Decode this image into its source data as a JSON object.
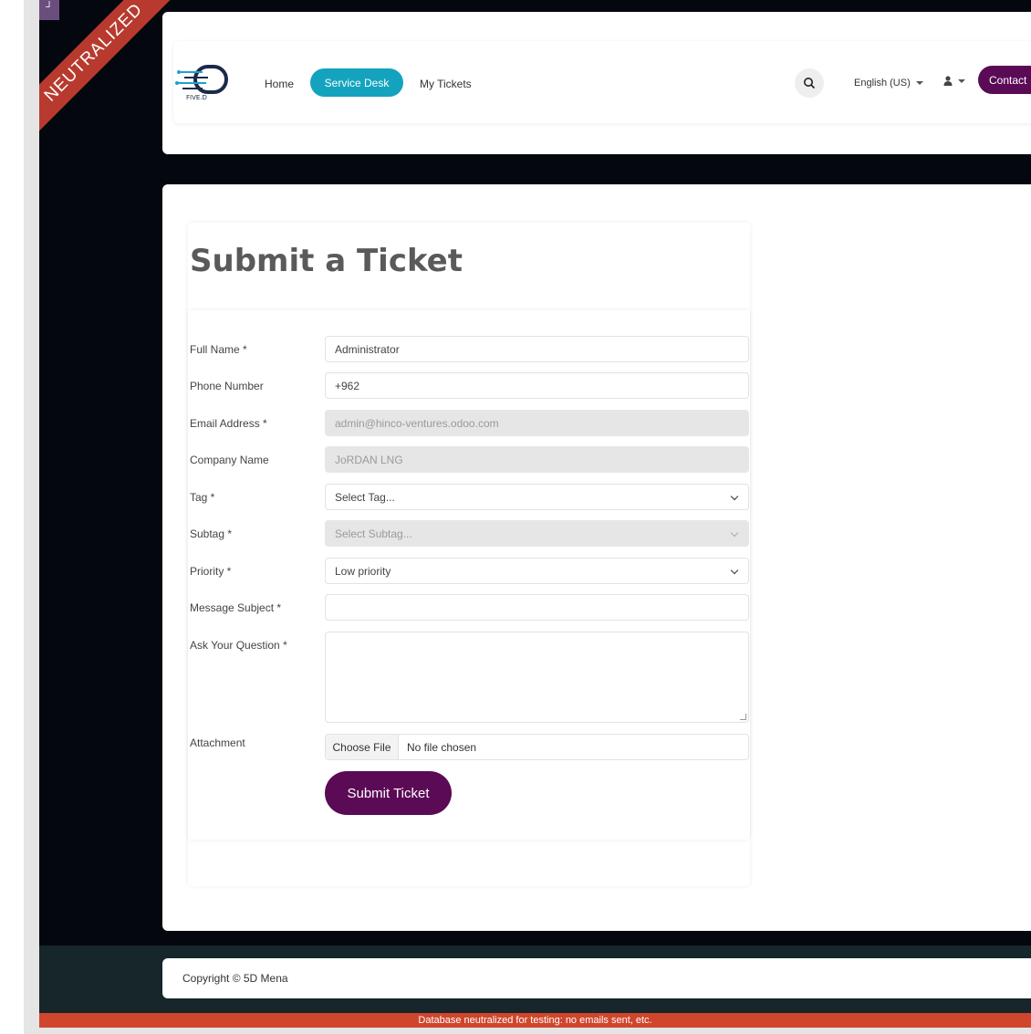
{
  "ribbon": {
    "text": "NEUTRALIZED",
    "corner_icon": "bracket-icon"
  },
  "header": {
    "logo_text": "FIVE.D",
    "nav": {
      "home": "Home",
      "service_desk": "Service Desk",
      "my_tickets": "My Tickets"
    },
    "search_icon": "search-icon",
    "language": "English (US)",
    "user_icon": "user-icon",
    "contact": "Contact"
  },
  "form": {
    "title": "Submit a Ticket",
    "fields": {
      "full_name": {
        "label": "Full Name *",
        "value": "Administrator"
      },
      "phone": {
        "label": "Phone Number",
        "value": "+962"
      },
      "email": {
        "label": "Email Address *",
        "value": "admin@hinco-ventures.odoo.com"
      },
      "company": {
        "label": "Company Name",
        "value": "JoRDAN LNG"
      },
      "tag": {
        "label": "Tag *",
        "value": "Select Tag..."
      },
      "subtag": {
        "label": "Subtag *",
        "value": "Select Subtag..."
      },
      "priority": {
        "label": "Priority *",
        "value": "Low priority"
      },
      "subject": {
        "label": "Message Subject *",
        "value": ""
      },
      "question": {
        "label": "Ask Your Question *",
        "value": ""
      },
      "attachment": {
        "label": "Attachment",
        "button": "Choose File",
        "status": "No file chosen"
      }
    },
    "submit": "Submit Ticket"
  },
  "footer": {
    "copyright": "Copyright © 5D Mena",
    "neutralized_notice": "Database neutralized for testing: no emails sent, etc."
  },
  "colors": {
    "accent_teal": "#14a3be",
    "brand_purple": "#5b0a56",
    "ribbon_red": "#b83a2e",
    "notice_red": "#cf462d"
  }
}
